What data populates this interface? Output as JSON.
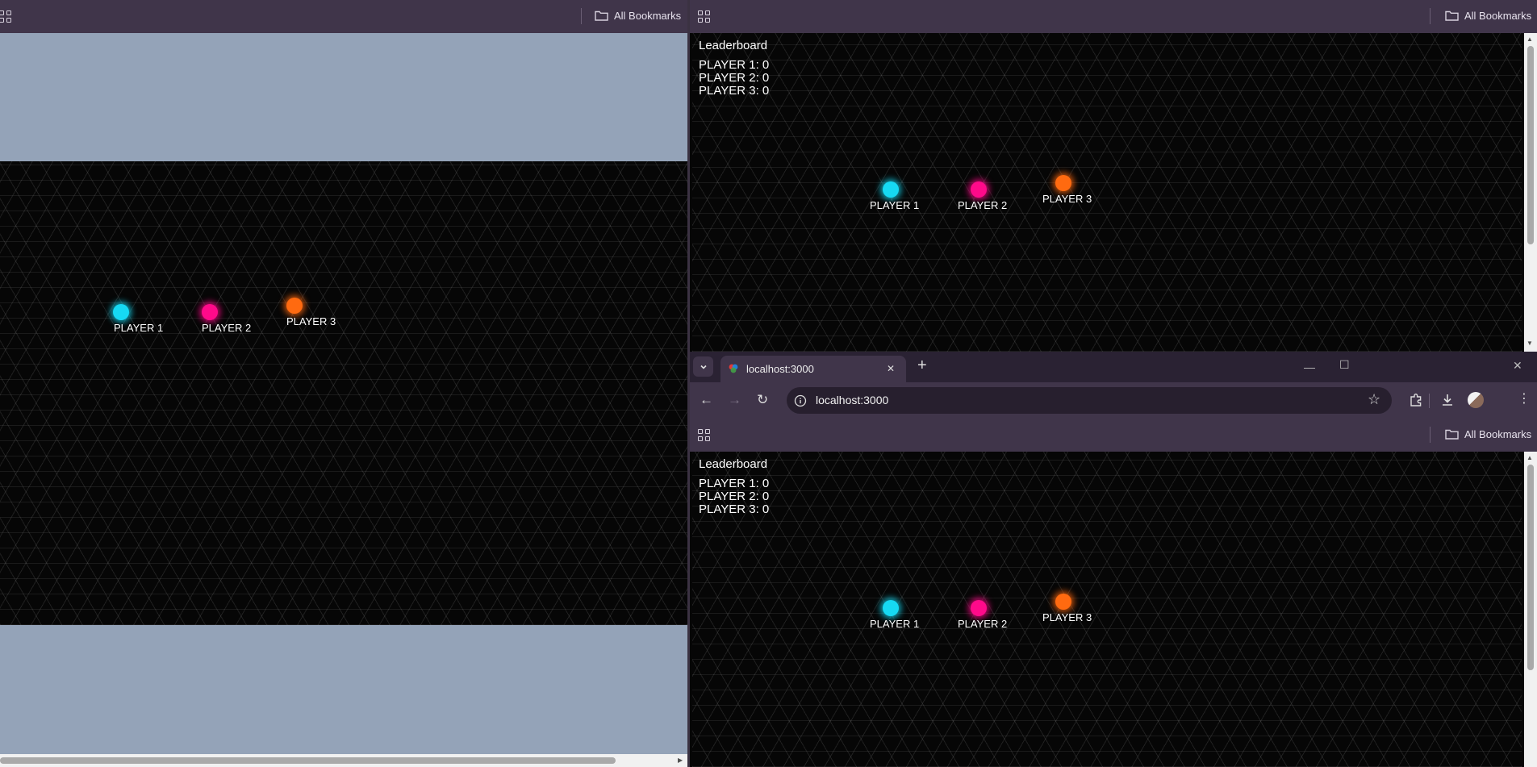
{
  "left_window": {
    "bookmarks_bar": {
      "all_bookmarks_label": "All Bookmarks"
    },
    "players": [
      {
        "name": "PLAYER 1",
        "color": "#16d9f3"
      },
      {
        "name": "PLAYER 2",
        "color": "#ff0a8a"
      },
      {
        "name": "PLAYER 3",
        "color": "#ff6a10"
      }
    ],
    "page_background": "#94a3b8"
  },
  "right_top_window": {
    "bookmarks_bar": {
      "all_bookmarks_label": "All Bookmarks"
    },
    "leaderboard": {
      "title": "Leaderboard",
      "entries": [
        "PLAYER 1: 0",
        "PLAYER 2: 0",
        "PLAYER 3: 0"
      ]
    },
    "players": [
      {
        "name": "PLAYER 1"
      },
      {
        "name": "PLAYER 2"
      },
      {
        "name": "PLAYER 3"
      }
    ]
  },
  "right_bottom_window": {
    "tab": {
      "title": "localhost:3000",
      "close_glyph": "✕",
      "new_tab_glyph": "+"
    },
    "address_bar": {
      "url": "localhost:3000"
    },
    "bookmarks_bar": {
      "all_bookmarks_label": "All Bookmarks"
    },
    "leaderboard": {
      "title": "Leaderboard",
      "entries": [
        "PLAYER 1: 0",
        "PLAYER 2: 0",
        "PLAYER 3: 0"
      ]
    },
    "players": [
      {
        "name": "PLAYER 1"
      },
      {
        "name": "PLAYER 2"
      },
      {
        "name": "PLAYER 3"
      }
    ]
  },
  "theme": {
    "browser_chrome": "#40354a",
    "tab_strip": "#2a2233",
    "game_background": "#060606",
    "player_1_color": "#16d9f3",
    "player_2_color": "#ff0a8a",
    "player_3_color": "#ff6a10"
  }
}
